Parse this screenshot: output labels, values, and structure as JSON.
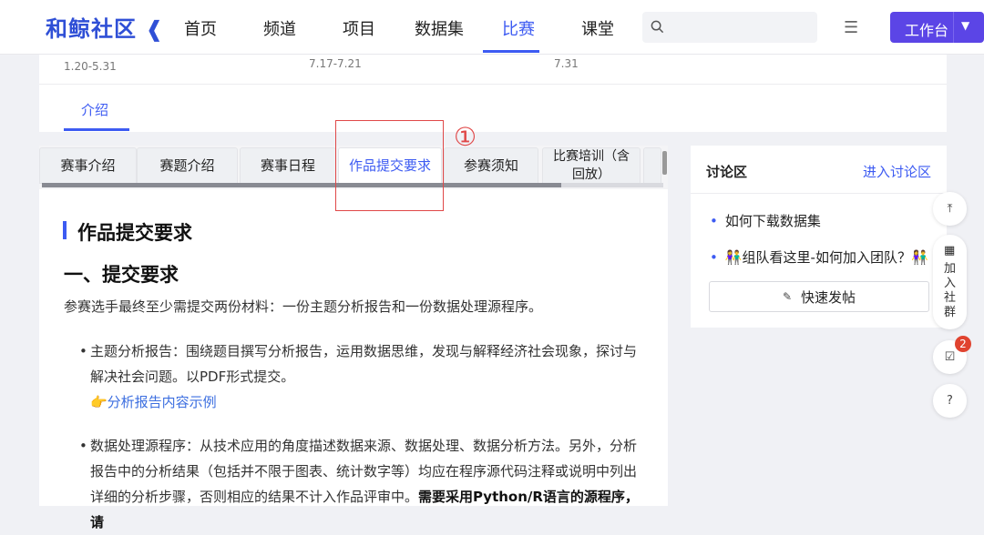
{
  "header": {
    "logo": "和鲸社区",
    "nav": [
      "首页",
      "频道",
      "项目",
      "数据集",
      "比赛",
      "课堂"
    ],
    "active_nav": "比赛",
    "workbench_label": "工作台"
  },
  "dates": [
    "1.20-5.31",
    "7.17-7.21",
    "7.31"
  ],
  "intro_tab": "介绍",
  "tabs": [
    "赛事介绍",
    "赛题介绍",
    "赛事日程",
    "作品提交要求",
    "参赛须知",
    "比赛培训（含回放）"
  ],
  "active_tab": "作品提交要求",
  "annotation_number": "①",
  "content": {
    "heading": "作品提交要求",
    "subheading": "一、提交要求",
    "intro": "参赛选手最终至少需提交两份材料：一份主题分析报告和一份数据处理源程序。",
    "bullet1_line1": "主题分析报告：围绕题目撰写分析报告，运用数据思维，发现与解释经济社会现象，探讨与",
    "bullet1_line2": "解决社会问题。以PDF形式提交。",
    "bullet1_link": "👉分析报告内容示例",
    "bullet2_line1": "数据处理源程序：从技术应用的角度描述数据来源、数据处理、数据分析方法。另外，分析",
    "bullet2_line2": "报告中的分析结果（包括并不限于图表、统计数字等）均应在程序源代码注释或说明中列出",
    "bullet2_line3_normal": "详细的分析步骤，否则相应的结果不计入作品评审中。",
    "bullet2_line3_bold": "需要采用Python/R语言的源程序，请"
  },
  "discussion": {
    "title": "讨论区",
    "enter": "进入讨论区",
    "items": [
      "如何下载数据集",
      "👫组队看这里-如何加入团队？👫"
    ],
    "post_button": "快速发帖"
  },
  "floating": {
    "group_label": "加入社群",
    "badge_count": "2"
  }
}
